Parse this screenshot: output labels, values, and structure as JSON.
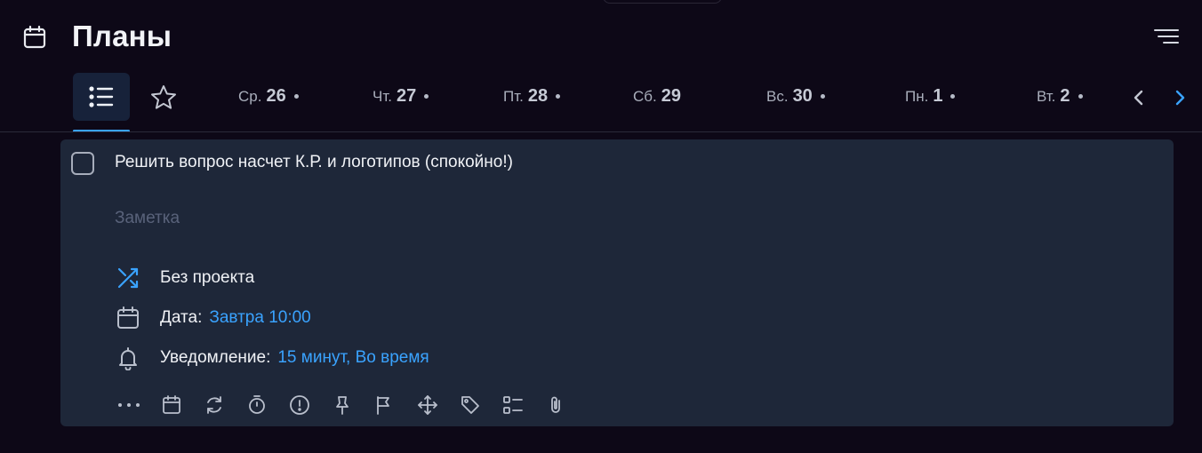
{
  "header": {
    "title": "Планы",
    "calendar_icon": "calendar-icon",
    "menu_icon": "filter-menu-icon"
  },
  "tabs": {
    "list_icon": "list-icon",
    "star_icon": "star-icon",
    "days": [
      {
        "name": "Ср.",
        "num": "26",
        "has_dot": true
      },
      {
        "name": "Чт.",
        "num": "27",
        "has_dot": true
      },
      {
        "name": "Пт.",
        "num": "28",
        "has_dot": true
      },
      {
        "name": "Сб.",
        "num": "29",
        "has_dot": false
      },
      {
        "name": "Вс.",
        "num": "30",
        "has_dot": true
      },
      {
        "name": "Пн.",
        "num": "1",
        "has_dot": true
      },
      {
        "name": "Вт.",
        "num": "2",
        "has_dot": true
      }
    ],
    "prev_icon": "chevron-left-icon",
    "next_icon": "chevron-right-icon"
  },
  "task": {
    "title": "Решить вопрос насчет К.Р. и логотипов (спокойно!)",
    "note_placeholder": "Заметка",
    "project": {
      "label": "Без проекта",
      "icon": "shuffle-icon"
    },
    "date": {
      "label": "Дата:",
      "value": "Завтра 10:00",
      "icon": "calendar-icon"
    },
    "notification": {
      "label": "Уведомление:",
      "value": "15 минут, Во время",
      "icon": "bell-icon"
    },
    "toolbar_icons": [
      "more-icon",
      "calendar-icon",
      "repeat-icon",
      "timer-icon",
      "priority-icon",
      "pin-icon",
      "flag-icon",
      "move-icon",
      "tag-icon",
      "checklist-icon",
      "attachment-icon"
    ]
  },
  "colors": {
    "background": "#0d0817",
    "card": "#1e2739",
    "accent": "#3aa3ff",
    "text": "#f0f2f6",
    "muted": "#59627a"
  }
}
